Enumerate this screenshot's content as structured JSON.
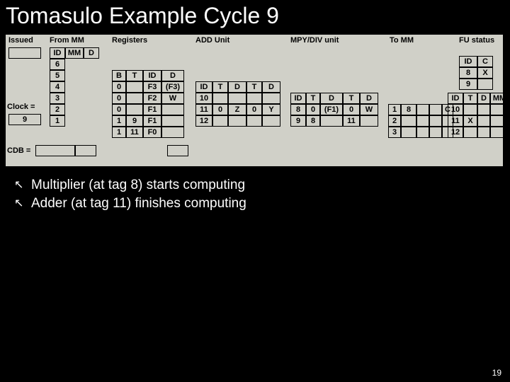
{
  "title": "Tomasulo Example Cycle 9",
  "page": "19",
  "headers": {
    "issued": "Issued",
    "fromMM": "From MM",
    "registers": "Registers",
    "addUnit": "ADD Unit",
    "mpyDivUnit": "MPY/DIV unit",
    "toMM": "To MM",
    "fuStatus": "FU status"
  },
  "labels": {
    "clock": "Clock =",
    "cdb": "CDB ="
  },
  "clock_value": "9",
  "fromMM": {
    "header": [
      "ID",
      "MM",
      "D"
    ],
    "rows": [
      "6",
      "5",
      "4",
      "3",
      "2",
      "1"
    ]
  },
  "registers": {
    "header": [
      "B",
      "T",
      "ID",
      "D"
    ],
    "rows": [
      [
        "0",
        "",
        "F3",
        "(F3)"
      ],
      [
        "0",
        "",
        "F2",
        "W"
      ],
      [
        "0",
        "",
        "F1",
        ""
      ],
      [
        "1",
        "9",
        "F1",
        ""
      ],
      [
        "1",
        "11",
        "F0",
        ""
      ]
    ]
  },
  "addUnit": {
    "header": [
      "ID",
      "T",
      "D",
      "T",
      "D"
    ],
    "rows": [
      [
        "10",
        "",
        "",
        "",
        ""
      ],
      [
        "11",
        "0",
        "Z",
        "0",
        "Y"
      ],
      [
        "12",
        "",
        "",
        "",
        ""
      ]
    ]
  },
  "mpyDivUnit": {
    "header": [
      "ID",
      "T",
      "D",
      "T",
      "D"
    ],
    "rows": [
      [
        "8",
        "0",
        "(F1)",
        "0",
        "W"
      ],
      [
        "9",
        "8",
        "",
        "11",
        ""
      ]
    ]
  },
  "toMM": {
    "rows": [
      [
        "1",
        "8",
        "",
        "",
        "C"
      ],
      [
        "2",
        "",
        "",
        "",
        ""
      ],
      [
        "3",
        "",
        "",
        "",
        ""
      ]
    ]
  },
  "fuStatus": {
    "header": [
      "ID",
      "C"
    ],
    "rows": [
      [
        "8",
        "X"
      ],
      [
        "9",
        ""
      ]
    ],
    "lower_header": [
      "ID",
      "T",
      "D",
      "MM"
    ],
    "lower_rows": [
      [
        "10",
        "",
        "",
        ""
      ],
      [
        "11",
        "X",
        "",
        ""
      ],
      [
        "12",
        "",
        "",
        ""
      ]
    ]
  },
  "bullets": [
    "Multiplier (at tag 8) starts computing",
    "Adder (at tag 11) finishes computing"
  ],
  "chart_data": {
    "type": "table",
    "title": "Tomasulo Example Cycle 9",
    "clock": 9,
    "cdb": null,
    "issued": null,
    "from_mm_queue": [
      6,
      5,
      4,
      3,
      2,
      1
    ],
    "registers": [
      {
        "busy": 0,
        "tag": null,
        "id": "F3",
        "data": "(F3)"
      },
      {
        "busy": 0,
        "tag": null,
        "id": "F2",
        "data": "W"
      },
      {
        "busy": 0,
        "tag": null,
        "id": "F1",
        "data": null
      },
      {
        "busy": 1,
        "tag": 9,
        "id": "F1",
        "data": null
      },
      {
        "busy": 1,
        "tag": 11,
        "id": "F0",
        "data": null
      }
    ],
    "add_unit": [
      {
        "id": 10,
        "t1": null,
        "d1": null,
        "t2": null,
        "d2": null
      },
      {
        "id": 11,
        "t1": 0,
        "d1": "Z",
        "t2": 0,
        "d2": "Y"
      },
      {
        "id": 12,
        "t1": null,
        "d1": null,
        "t2": null,
        "d2": null
      }
    ],
    "mpy_div_unit": [
      {
        "id": 8,
        "t1": 0,
        "d1": "(F1)",
        "t2": 0,
        "d2": "W"
      },
      {
        "id": 9,
        "t1": 8,
        "d1": null,
        "t2": 11,
        "d2": null
      }
    ],
    "to_mm": [
      {
        "slot": 1,
        "tag": 8,
        "data": null,
        "extra": "C"
      },
      {
        "slot": 2,
        "tag": null,
        "data": null,
        "extra": null
      },
      {
        "slot": 3,
        "tag": null,
        "data": null,
        "extra": null
      }
    ],
    "fu_status": [
      {
        "id": 8,
        "c": "X"
      },
      {
        "id": 9,
        "c": null
      },
      {
        "id": 10,
        "t": null,
        "d": null,
        "mm": null
      },
      {
        "id": 11,
        "t": "X",
        "d": null,
        "mm": null
      },
      {
        "id": 12,
        "t": null,
        "d": null,
        "mm": null
      }
    ]
  }
}
